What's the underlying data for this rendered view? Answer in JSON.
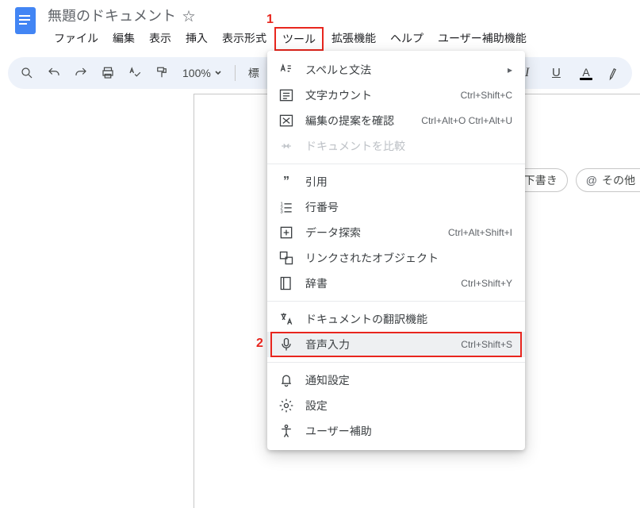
{
  "app": {
    "doc_title": "無題のドキュメント"
  },
  "menubar": {
    "file": "ファイル",
    "edit": "編集",
    "view": "表示",
    "insert": "挿入",
    "format": "表示形式",
    "tools": "ツール",
    "ext": "拡張機能",
    "help": "ヘルプ",
    "a11y": "ユーザー補助機能"
  },
  "toolbar": {
    "zoom": "100%",
    "style_prefix": "標"
  },
  "chips": {
    "draft_label": "下書き",
    "other_label": "その他"
  },
  "annotations": {
    "one": "1",
    "two": "2"
  },
  "tools_menu": {
    "spelling": {
      "label": "スペルと文法"
    },
    "wordcount": {
      "label": "文字カウント",
      "kbd": "Ctrl+Shift+C"
    },
    "review": {
      "label": "編集の提案を確認",
      "kbd": "Ctrl+Alt+O Ctrl+Alt+U"
    },
    "compare": {
      "label": "ドキュメントを比較"
    },
    "citations": {
      "label": "引用"
    },
    "linenumbers": {
      "label": "行番号"
    },
    "explore": {
      "label": "データ探索",
      "kbd": "Ctrl+Alt+Shift+I"
    },
    "linked": {
      "label": "リンクされたオブジェクト"
    },
    "dictionary": {
      "label": "辞書",
      "kbd": "Ctrl+Shift+Y"
    },
    "translate": {
      "label": "ドキュメントの翻訳機能"
    },
    "voice": {
      "label": "音声入力",
      "kbd": "Ctrl+Shift+S"
    },
    "notify": {
      "label": "通知設定"
    },
    "prefs": {
      "label": "設定"
    },
    "a11y": {
      "label": "ユーザー補助"
    }
  }
}
